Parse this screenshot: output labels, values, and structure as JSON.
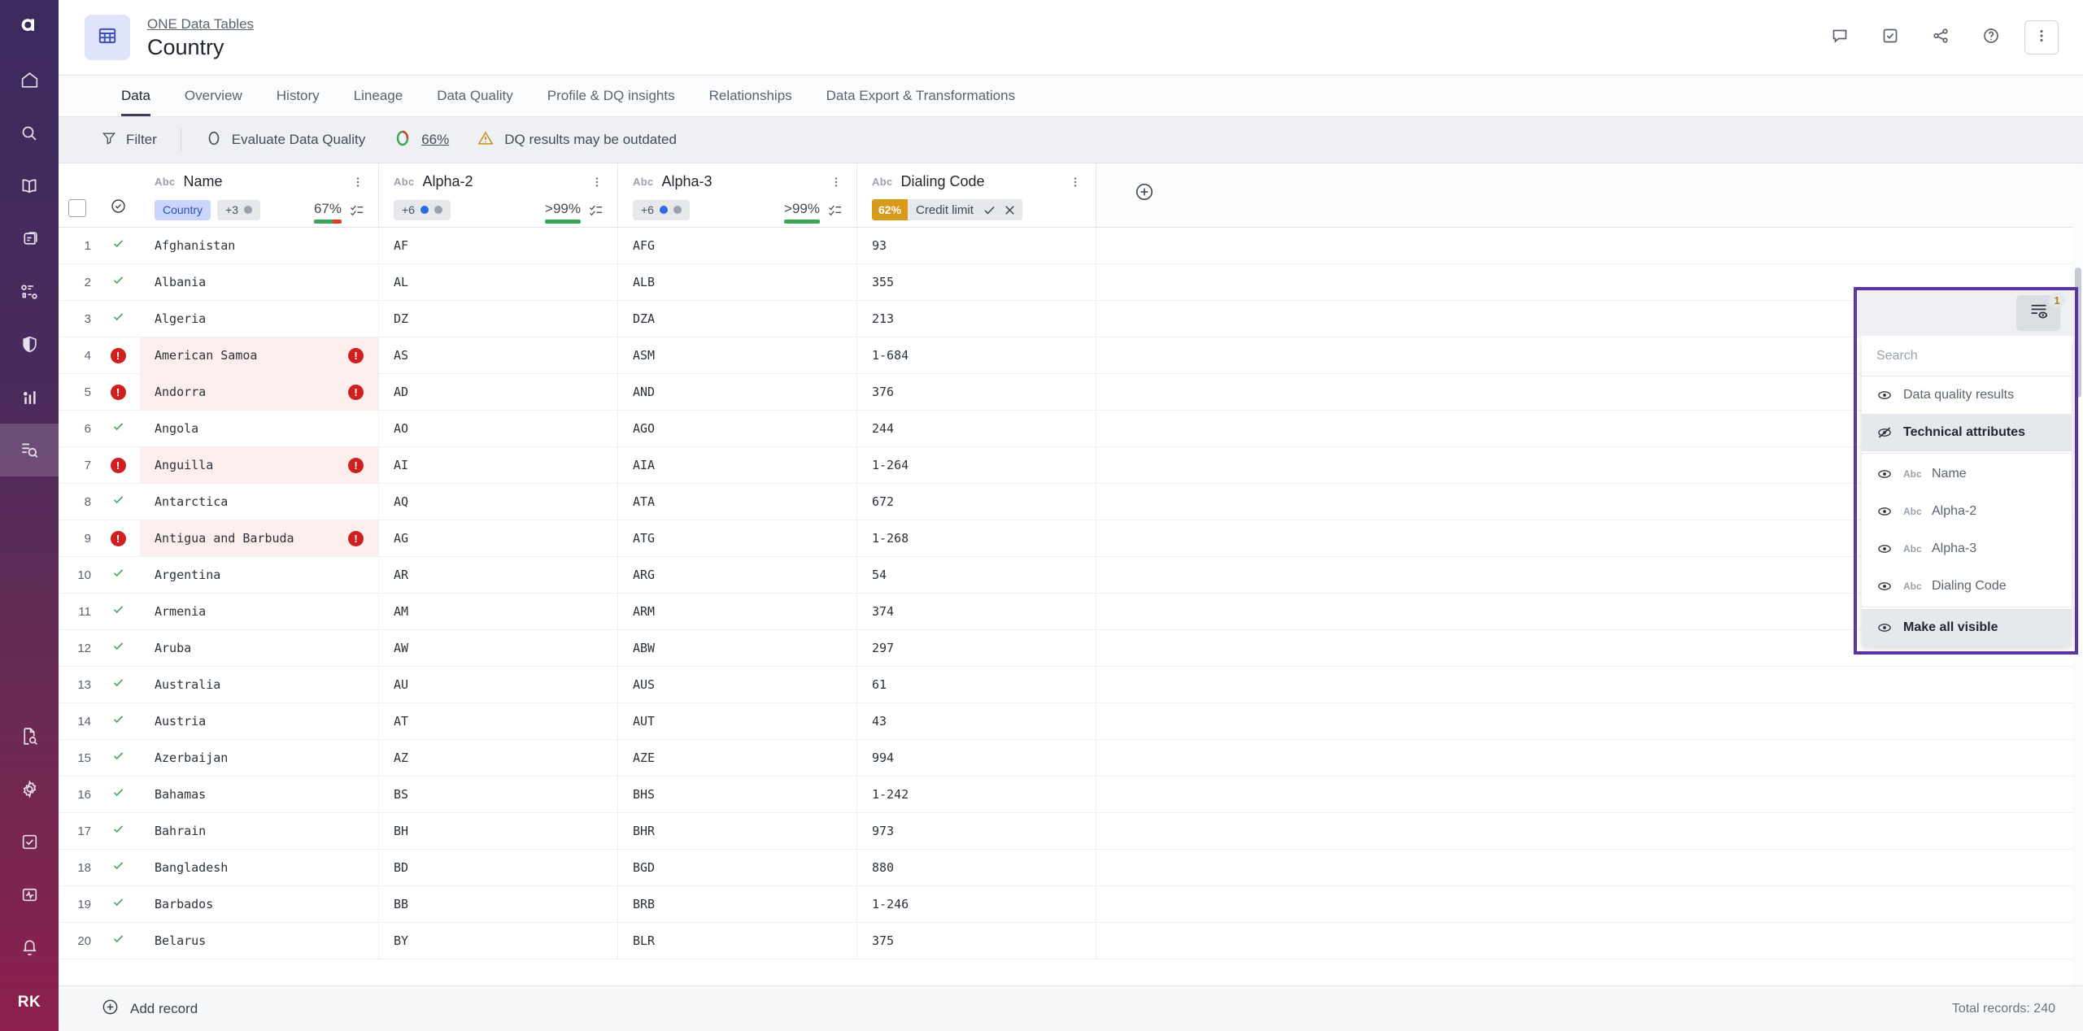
{
  "rail": {
    "logo": "ataccama-logo",
    "items": [
      {
        "name": "home-icon",
        "label": "Home"
      },
      {
        "name": "search-icon",
        "label": "Search"
      },
      {
        "name": "catalog-book-icon",
        "label": "Knowledge Catalog"
      },
      {
        "name": "folders-icon",
        "label": "Sources"
      },
      {
        "name": "model-icon",
        "label": "Data Model"
      },
      {
        "name": "shield-icon",
        "label": "Governance"
      },
      {
        "name": "chart-bars-icon",
        "label": "Reports"
      },
      {
        "name": "data-tables-icon",
        "label": "ONE Data Tables",
        "active": true
      },
      {
        "name": "document-search-icon",
        "label": "Data Stories"
      },
      {
        "name": "gear-icon",
        "label": "Settings"
      },
      {
        "name": "checkbox-icon",
        "label": "Tasks"
      },
      {
        "name": "monitoring-icon",
        "label": "Monitoring"
      },
      {
        "name": "bell-icon",
        "label": "Notifications"
      }
    ],
    "avatar": "RK"
  },
  "header": {
    "breadcrumb": "ONE Data Tables",
    "title": "Country",
    "actions": [
      {
        "name": "comment-icon",
        "label": "Comments"
      },
      {
        "name": "task-checkbox-icon",
        "label": "Tasks"
      },
      {
        "name": "share-icon",
        "label": "Share"
      },
      {
        "name": "help-icon",
        "label": "Help"
      },
      {
        "name": "more-vertical-icon",
        "label": "More"
      }
    ]
  },
  "tabs": [
    {
      "label": "Data",
      "active": true
    },
    {
      "label": "Overview",
      "active": false
    },
    {
      "label": "History",
      "active": false
    },
    {
      "label": "Lineage",
      "active": false
    },
    {
      "label": "Data Quality",
      "active": false
    },
    {
      "label": "Profile & DQ insights",
      "active": false
    },
    {
      "label": "Relationships",
      "active": false
    },
    {
      "label": "Data Export & Transformations",
      "active": false
    }
  ],
  "toolbar": {
    "filter_label": "Filter",
    "evaluate_label": "Evaluate Data Quality",
    "score_label": "66%",
    "score_value": 66,
    "warning_label": "DQ results may be outdated"
  },
  "columns": [
    {
      "abc": "Abc",
      "name": "Name",
      "chips": [
        {
          "text": "Country",
          "style": "blue",
          "dot": null
        },
        {
          "text": "+3",
          "style": "grey",
          "dot": "grey"
        }
      ],
      "score": "67%",
      "score_green_pct": 67,
      "score_colors": {
        "good": "#3aa655",
        "bad": "#e03b2f"
      }
    },
    {
      "abc": "Abc",
      "name": "Alpha-2",
      "chips": [
        {
          "text": "+6",
          "style": "grey",
          "dot": "blue",
          "dot2": "grey"
        }
      ],
      "score": ">99%",
      "score_green_pct": 100,
      "score_colors": {
        "good": "#3aa655",
        "bad": "#e03b2f"
      }
    },
    {
      "abc": "Abc",
      "name": "Alpha-3",
      "chips": [
        {
          "text": "+6",
          "style": "grey",
          "dot": "blue",
          "dot2": "grey"
        }
      ],
      "score": ">99%",
      "score_green_pct": 100,
      "score_colors": {
        "good": "#3aa655",
        "bad": "#e03b2f"
      }
    },
    {
      "abc": "Abc",
      "name": "Dialing Code",
      "credit_chip": {
        "pct": "62%",
        "label": "Credit limit",
        "accept": "check",
        "reject": "close"
      },
      "score": null
    }
  ],
  "rows": [
    {
      "n": "1",
      "status": "ok",
      "name": "Afghanistan",
      "a2": "AF",
      "a3": "AFG",
      "dial": "93"
    },
    {
      "n": "2",
      "status": "ok",
      "name": "Albania",
      "a2": "AL",
      "a3": "ALB",
      "dial": "355"
    },
    {
      "n": "3",
      "status": "ok",
      "name": "Algeria",
      "a2": "DZ",
      "a3": "DZA",
      "dial": "213"
    },
    {
      "n": "4",
      "status": "err",
      "name": "American Samoa",
      "a2": "AS",
      "a3": "ASM",
      "dial": "1-684"
    },
    {
      "n": "5",
      "status": "err",
      "name": "Andorra",
      "a2": "AD",
      "a3": "AND",
      "dial": "376"
    },
    {
      "n": "6",
      "status": "ok",
      "name": "Angola",
      "a2": "AO",
      "a3": "AGO",
      "dial": "244"
    },
    {
      "n": "7",
      "status": "err",
      "name": "Anguilla",
      "a2": "AI",
      "a3": "AIA",
      "dial": "1-264"
    },
    {
      "n": "8",
      "status": "ok",
      "name": "Antarctica",
      "a2": "AQ",
      "a3": "ATA",
      "dial": "672"
    },
    {
      "n": "9",
      "status": "err",
      "name": "Antigua and Barbuda",
      "a2": "AG",
      "a3": "ATG",
      "dial": "1-268"
    },
    {
      "n": "10",
      "status": "ok",
      "name": "Argentina",
      "a2": "AR",
      "a3": "ARG",
      "dial": "54"
    },
    {
      "n": "11",
      "status": "ok",
      "name": "Armenia",
      "a2": "AM",
      "a3": "ARM",
      "dial": "374"
    },
    {
      "n": "12",
      "status": "ok",
      "name": "Aruba",
      "a2": "AW",
      "a3": "ABW",
      "dial": "297"
    },
    {
      "n": "13",
      "status": "ok",
      "name": "Australia",
      "a2": "AU",
      "a3": "AUS",
      "dial": "61"
    },
    {
      "n": "14",
      "status": "ok",
      "name": "Austria",
      "a2": "AT",
      "a3": "AUT",
      "dial": "43"
    },
    {
      "n": "15",
      "status": "ok",
      "name": "Azerbaijan",
      "a2": "AZ",
      "a3": "AZE",
      "dial": "994"
    },
    {
      "n": "16",
      "status": "ok",
      "name": "Bahamas",
      "a2": "BS",
      "a3": "BHS",
      "dial": "1-242"
    },
    {
      "n": "17",
      "status": "ok",
      "name": "Bahrain",
      "a2": "BH",
      "a3": "BHR",
      "dial": "973"
    },
    {
      "n": "18",
      "status": "ok",
      "name": "Bangladesh",
      "a2": "BD",
      "a3": "BGD",
      "dial": "880"
    },
    {
      "n": "19",
      "status": "ok",
      "name": "Barbados",
      "a2": "BB",
      "a3": "BRB",
      "dial": "1-246"
    },
    {
      "n": "20",
      "status": "ok",
      "name": "Belarus",
      "a2": "BY",
      "a3": "BLR",
      "dial": "375"
    }
  ],
  "popover": {
    "badge_count": "1",
    "search_placeholder": "Search",
    "groups": [
      {
        "items": [
          {
            "label": "Data quality results",
            "visible": true,
            "strong": false,
            "abc": null
          },
          {
            "label": "Technical attributes",
            "visible": false,
            "strong": true,
            "abc": null
          }
        ]
      },
      {
        "items": [
          {
            "label": "Name",
            "visible": true,
            "strong": false,
            "abc": "Abc"
          },
          {
            "label": "Alpha-2",
            "visible": true,
            "strong": false,
            "abc": "Abc"
          },
          {
            "label": "Alpha-3",
            "visible": true,
            "strong": false,
            "abc": "Abc"
          },
          {
            "label": "Dialing Code",
            "visible": true,
            "strong": false,
            "abc": "Abc"
          }
        ]
      },
      {
        "items": [
          {
            "label": "Make all visible",
            "visible": true,
            "strong": true,
            "abc": null
          }
        ]
      }
    ]
  },
  "footer": {
    "add_record": "Add record",
    "total_records": "Total records: 240"
  },
  "colors": {
    "accent_purple": "#5b35a8",
    "rail_top": "#3b2a5e",
    "rail_bottom": "#8d1f4e",
    "good_green": "#3aa655",
    "bad_red": "#cf2020",
    "amber": "#d79a1b",
    "chip_blue": "#c9d5fb"
  }
}
